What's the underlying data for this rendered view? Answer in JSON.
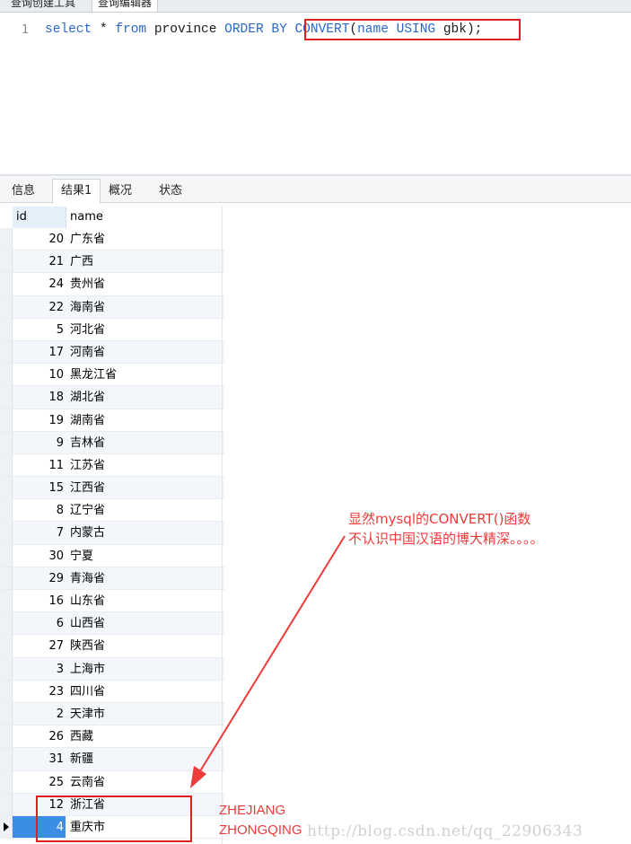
{
  "top_tabs": [
    "查询创建工具",
    "查询编辑器"
  ],
  "editor": {
    "line_number": "1",
    "tokens": [
      {
        "t": "select",
        "c": "kw"
      },
      {
        "t": " * ",
        "c": "pl"
      },
      {
        "t": "from",
        "c": "kw"
      },
      {
        "t": " province ",
        "c": "pl"
      },
      {
        "t": "ORDER BY",
        "c": "kw"
      },
      {
        "t": " ",
        "c": "pl"
      },
      {
        "t": "CONVERT",
        "c": "kw"
      },
      {
        "t": "(",
        "c": "pl"
      },
      {
        "t": "name",
        "c": "kw"
      },
      {
        "t": " ",
        "c": "pl"
      },
      {
        "t": "USING",
        "c": "kw"
      },
      {
        "t": " gbk);",
        "c": "pl"
      }
    ]
  },
  "result_tabs": [
    {
      "label": "信息",
      "active": false
    },
    {
      "label": "结果1",
      "active": true
    },
    {
      "label": "概况",
      "active": false
    },
    {
      "label": "状态",
      "active": false
    }
  ],
  "grid": {
    "columns": [
      "id",
      "name"
    ],
    "rows": [
      {
        "id": "20",
        "name": "广东省"
      },
      {
        "id": "21",
        "name": "广西"
      },
      {
        "id": "24",
        "name": "贵州省"
      },
      {
        "id": "22",
        "name": "海南省"
      },
      {
        "id": "5",
        "name": "河北省"
      },
      {
        "id": "17",
        "name": "河南省"
      },
      {
        "id": "10",
        "name": "黑龙江省"
      },
      {
        "id": "18",
        "name": "湖北省"
      },
      {
        "id": "19",
        "name": "湖南省"
      },
      {
        "id": "9",
        "name": "吉林省"
      },
      {
        "id": "11",
        "name": "江苏省"
      },
      {
        "id": "15",
        "name": "江西省"
      },
      {
        "id": "8",
        "name": "辽宁省"
      },
      {
        "id": "7",
        "name": "内蒙古"
      },
      {
        "id": "30",
        "name": "宁夏"
      },
      {
        "id": "29",
        "name": "青海省"
      },
      {
        "id": "16",
        "name": "山东省"
      },
      {
        "id": "6",
        "name": "山西省"
      },
      {
        "id": "27",
        "name": "陕西省"
      },
      {
        "id": "3",
        "name": "上海市"
      },
      {
        "id": "23",
        "name": "四川省"
      },
      {
        "id": "2",
        "name": "天津市"
      },
      {
        "id": "26",
        "name": "西藏"
      },
      {
        "id": "31",
        "name": "新疆"
      },
      {
        "id": "25",
        "name": "云南省"
      },
      {
        "id": "12",
        "name": "浙江省"
      },
      {
        "id": "4",
        "name": "重庆市"
      }
    ],
    "selected_row": 26
  },
  "annotation": {
    "line1": "显然mysql的CONVERT()函数",
    "line2": "不认识中国汉语的博大精深。。。。",
    "label1": "ZHEJIANG",
    "label2": "ZHONGQING",
    "color": "#ee3a3a"
  },
  "watermark": "http://blog.csdn.net/qq_22906343"
}
